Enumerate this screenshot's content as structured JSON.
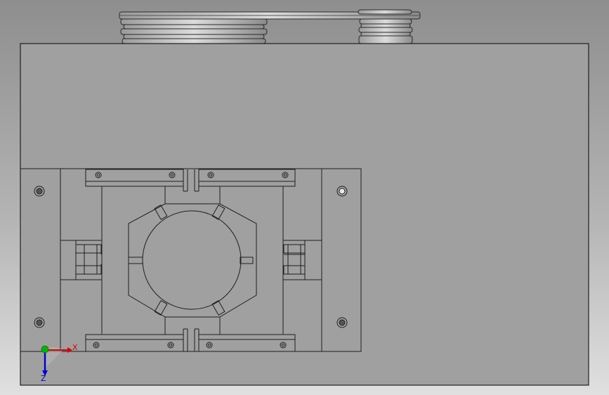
{
  "viewport": {
    "view_orientation": "front",
    "background_style": "gradient-gray"
  },
  "colors": {
    "part_face": "#a0a0a0",
    "part_edge": "#1e1e1e",
    "pulley_edge": "#2a2a2a",
    "axis_x": "#e00000",
    "axis_y": "#00b400",
    "axis_z": "#0000d0"
  },
  "triad": {
    "x_label": "X",
    "z_label": "Z"
  },
  "icons": {
    "triad": "coordinate-triad-icon"
  }
}
